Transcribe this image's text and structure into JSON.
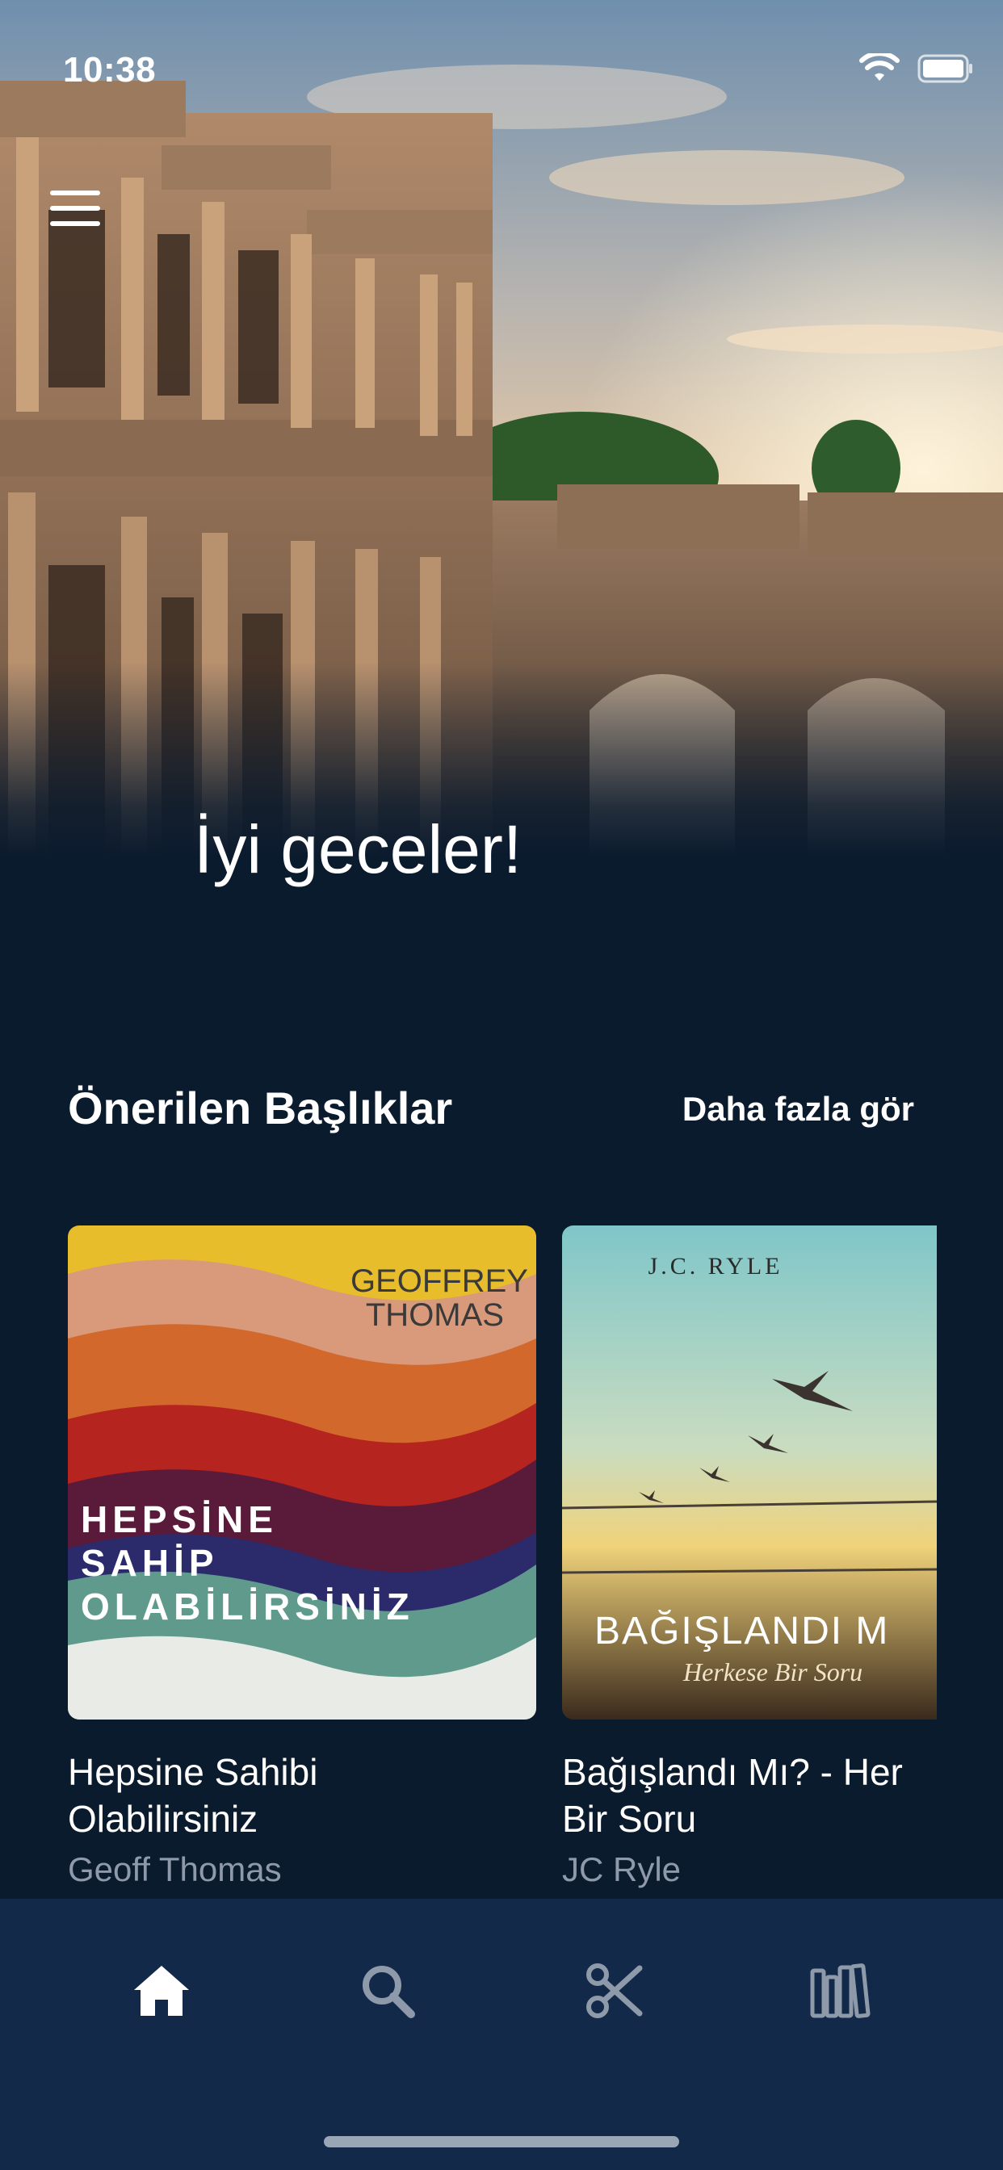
{
  "status_bar": {
    "time": "10:38"
  },
  "greeting": "İyi geceler!",
  "section": {
    "title": "Önerilen Başlıklar",
    "see_more": "Daha fazla gör"
  },
  "books": [
    {
      "title_line1": "Hepsine Sahibi",
      "title_line2": "Olabilirsiniz",
      "author": "Geoff Thomas",
      "cover_author_line1": "GEOFFREY",
      "cover_author_line2": "THOMAS",
      "cover_title_line1": "HEPSİNE",
      "cover_title_line2": "SAHİP",
      "cover_title_line3": "OLABİLİRSİNİZ"
    },
    {
      "title_line1": "Bağışlandı Mı? - Her",
      "title_line2": "Bir Soru",
      "author": "JC Ryle",
      "cover_author": "J.C. RYLE",
      "cover_title": "BAĞIŞLANDI M",
      "cover_subtitle": "Herkese Bir Soru"
    }
  ],
  "nav": {
    "items": [
      {
        "icon": "home-icon",
        "active": true
      },
      {
        "icon": "search-icon",
        "active": false
      },
      {
        "icon": "scissors-icon",
        "active": false
      },
      {
        "icon": "library-icon",
        "active": false
      }
    ]
  },
  "colors": {
    "background": "#0b1b2e",
    "nav_background": "#12294a",
    "active_icon": "#ffffff",
    "inactive_icon": "#8e9aa9",
    "author_text": "#8e9aa9"
  }
}
